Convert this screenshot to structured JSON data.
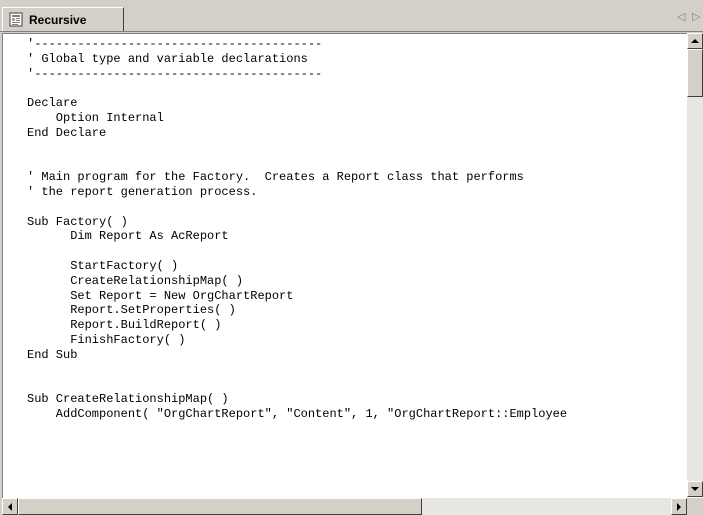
{
  "tab": {
    "label": "Recursive",
    "icon": "report-file-icon"
  },
  "tab_nav": {
    "prev_icon": "◁",
    "next_icon": "▷"
  },
  "editor": {
    "lines": [
      "'----------------------------------------",
      "' Global type and variable declarations",
      "'----------------------------------------",
      "",
      "Declare",
      "    Option Internal",
      "End Declare",
      "",
      "",
      "' Main program for the Factory.  Creates a Report class that performs",
      "' the report generation process.",
      "",
      "Sub Factory( )",
      "      Dim Report As AcReport",
      "",
      "      StartFactory( )",
      "      CreateRelationshipMap( )",
      "      Set Report = New OrgChartReport",
      "      Report.SetProperties( )",
      "      Report.BuildReport( )",
      "      FinishFactory( )",
      "End Sub",
      "",
      "",
      "Sub CreateRelationshipMap( )",
      "    AddComponent( \"OrgChartReport\", \"Content\", 1, \"OrgChartReport::Employee"
    ]
  },
  "colors": {
    "chrome": "#d4d0c8",
    "editor_bg": "#ffffff",
    "text": "#000000",
    "scroll_track": "#e8e6e2"
  }
}
